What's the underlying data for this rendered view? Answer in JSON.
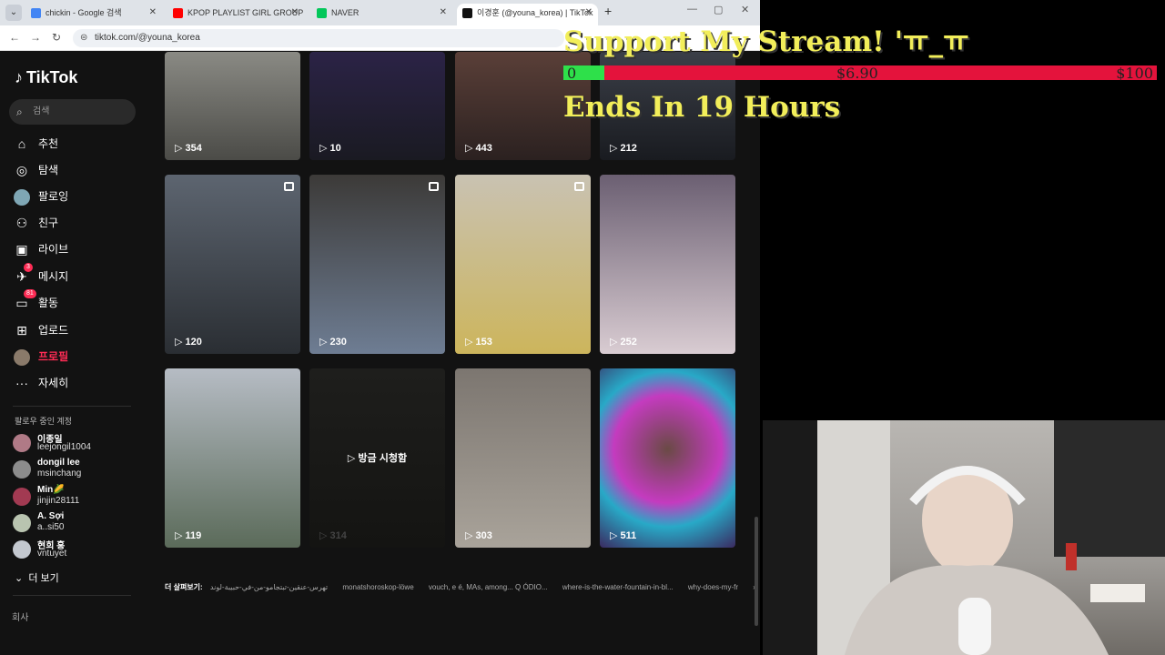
{
  "browser": {
    "tabs": [
      {
        "title": "chickin - Google 검색",
        "favicon_color": "#4285f4"
      },
      {
        "title": "KPOP PLAYLIST GIRL GROUP",
        "favicon_color": "#ff0000"
      },
      {
        "title": "NAVER",
        "favicon_color": "#03c75a"
      },
      {
        "title": "이경훈 (@youna_korea) | TikTok",
        "favicon_color": "#111111"
      }
    ],
    "url": "tiktok.com/@youna_korea"
  },
  "tiktok": {
    "logo": "TikTok",
    "search_placeholder": "검색",
    "menu": [
      {
        "label": "추천",
        "icon": "home-icon"
      },
      {
        "label": "탐색",
        "icon": "compass-icon"
      },
      {
        "label": "팔로잉",
        "icon": "following-avatar-icon"
      },
      {
        "label": "친구",
        "icon": "friends-icon"
      },
      {
        "label": "라이브",
        "icon": "live-icon"
      },
      {
        "label": "메시지",
        "icon": "message-icon",
        "badge": "3"
      },
      {
        "label": "활동",
        "icon": "activity-icon",
        "badge": "81"
      },
      {
        "label": "업로드",
        "icon": "upload-icon"
      },
      {
        "label": "프로필",
        "icon": "profile-avatar-icon"
      },
      {
        "label": "자세히",
        "icon": "more-dots-icon"
      }
    ],
    "following_title": "팔로우 중인 계정",
    "following": [
      {
        "name": "이종일",
        "handle": "leejongil1004"
      },
      {
        "name": "dongil lee",
        "handle": "msinchang"
      },
      {
        "name": "Min🌽",
        "handle": "jinjin28111"
      },
      {
        "name": "A. Sợi",
        "handle": "a..si50"
      },
      {
        "name": "현희 홍",
        "handle": "vntuyet"
      }
    ],
    "see_more": "더 보기",
    "company": "회사",
    "videos": [
      {
        "views": "354"
      },
      {
        "views": "10"
      },
      {
        "views": "443"
      },
      {
        "views": "212"
      },
      {
        "views": "120"
      },
      {
        "views": "230"
      },
      {
        "views": "153"
      },
      {
        "views": "252"
      },
      {
        "views": "119"
      },
      {
        "views": "314",
        "overlay": "▷ 방금 시청함"
      },
      {
        "views": "303"
      },
      {
        "views": "511"
      }
    ],
    "explore_label": "더 살펴보기:",
    "explore_links": [
      "تهرس-عنقين-تبتجامو-من-في-حبيبة-لوند",
      "monatshoroskop-löwe",
      "vouch, e é, MAs, among... Q ÓDIO...",
      "where-is-the-water-fountain-in-bl...",
      "why-does-my-fr"
    ]
  },
  "stream": {
    "title": "Support My Stream! 'ㅠ_ㅠ",
    "goal_start": "0",
    "goal_current": "$6.90",
    "goal_max": "$100",
    "goal_progress": 0.069,
    "ends": "Ends In 19 Hours"
  }
}
